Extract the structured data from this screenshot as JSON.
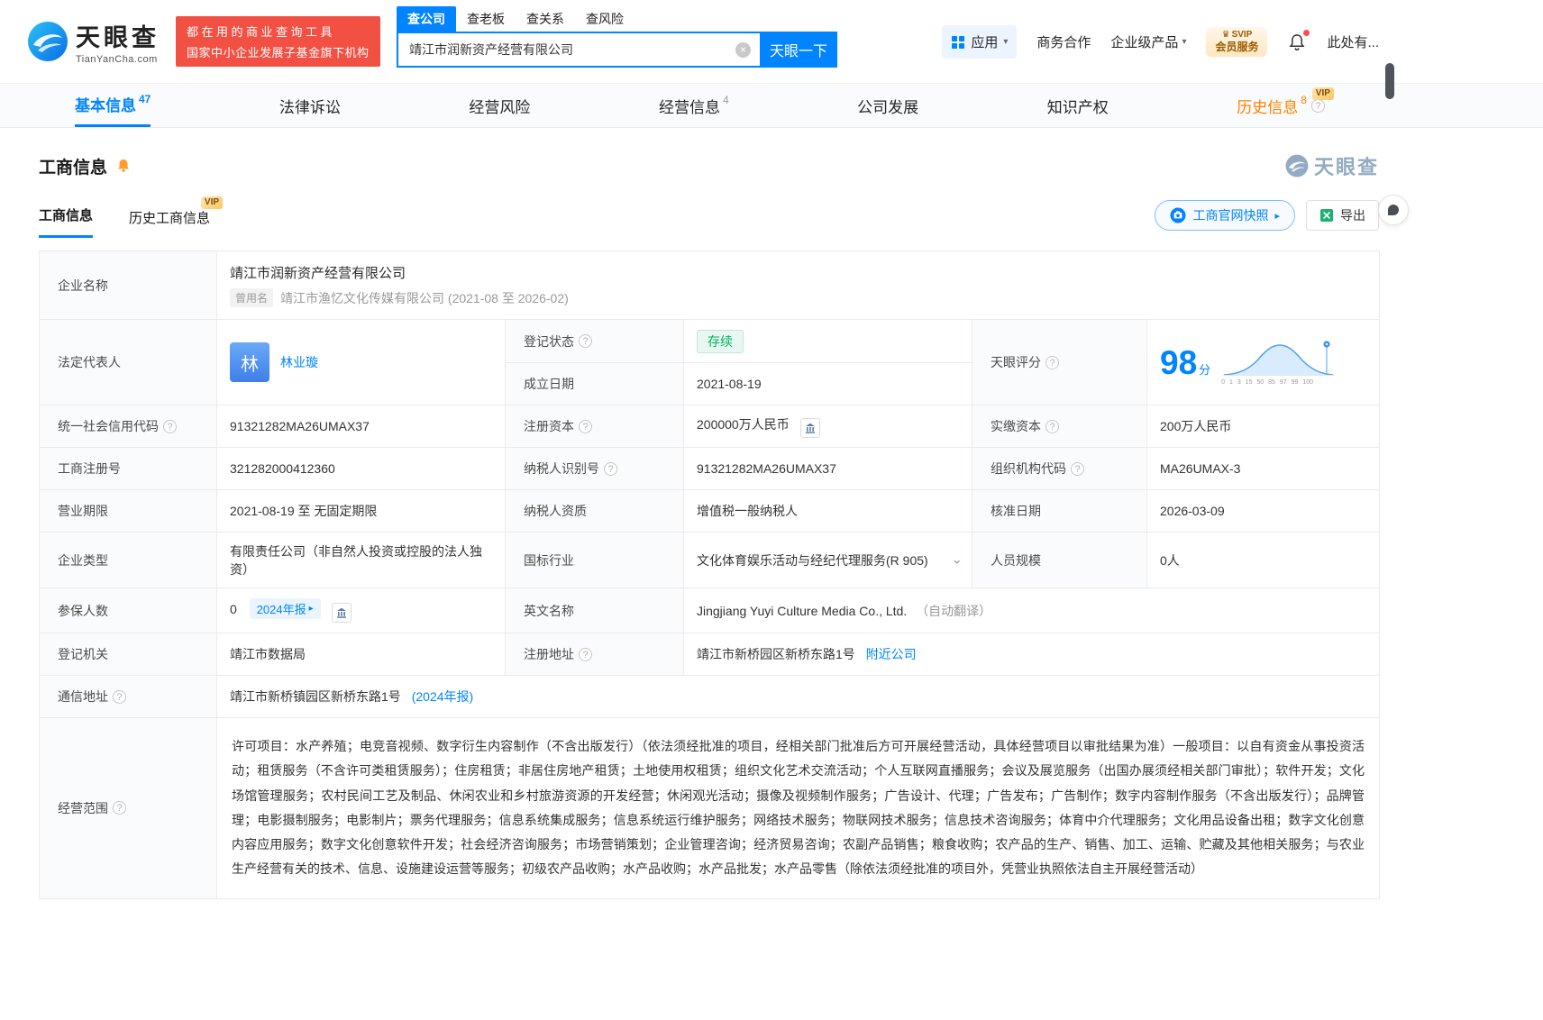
{
  "icons": {
    "help": "?",
    "caret_down": "▾",
    "arrow_right": "▸",
    "chevron_down": "⌄",
    "close": "×",
    "crown": "♛"
  },
  "badges": {
    "vip": "VIP"
  },
  "header": {
    "logo": {
      "cn": "天眼查",
      "en": "TianYanCha.com"
    },
    "promo": {
      "line1": "都在用的商业查询工具",
      "line2": "国家中小企业发展子基金旗下机构"
    },
    "search": {
      "tabs": [
        {
          "label": "查公司"
        },
        {
          "label": "查老板"
        },
        {
          "label": "查关系"
        },
        {
          "label": "查风险"
        }
      ],
      "value": "靖江市润新资产经营有限公司",
      "button": "天眼一下"
    },
    "menu": {
      "apps": "应用",
      "cooperation": "商务合作",
      "enterprise": "企业级产品",
      "svip_top": "SVIP",
      "svip_bottom": "会员服务",
      "more": "此处有..."
    }
  },
  "nav": [
    {
      "label": "基本信息",
      "count": "47"
    },
    {
      "label": "法律诉讼",
      "count": ""
    },
    {
      "label": "经营风险",
      "count": ""
    },
    {
      "label": "经营信息",
      "count": "4"
    },
    {
      "label": "公司发展",
      "count": ""
    },
    {
      "label": "知识产权",
      "count": ""
    },
    {
      "label": "历史信息",
      "count": "8"
    }
  ],
  "section": {
    "title": "工商信息",
    "brand": "天眼查",
    "tab_current": "工商信息",
    "tab_history": "历史工商信息",
    "snapshot": "工商官网快照",
    "export": "导出"
  },
  "table": {
    "company_name": {
      "label": "企业名称",
      "value": "靖江市润新资产经营有限公司",
      "former_badge": "曾用名",
      "former": "靖江市渔忆文化传媒有限公司 (2021-08 至 2026-02)"
    },
    "legal_rep": {
      "label": "法定代表人",
      "avatar": "林",
      "name": "林业璇"
    },
    "reg_status": {
      "label": "登记状态",
      "value": "存续"
    },
    "score": {
      "label": "天眼评分",
      "value": "98",
      "unit": "分",
      "axis": "0 1 3 15 50 85 97 99 100"
    },
    "established": {
      "label": "成立日期",
      "value": "2021-08-19"
    },
    "credit_code": {
      "label": "统一社会信用代码",
      "value": "91321282MA26UMAX37"
    },
    "reg_capital": {
      "label": "注册资本",
      "value": "200000万人民币"
    },
    "paid_capital": {
      "label": "实缴资本",
      "value": "200万人民币"
    },
    "reg_no": {
      "label": "工商注册号",
      "value": "321282000412360"
    },
    "tax_id": {
      "label": "纳税人识别号",
      "value": "91321282MA26UMAX37"
    },
    "org_code": {
      "label": "组织机构代码",
      "value": "MA26UMAX-3"
    },
    "term": {
      "label": "营业期限",
      "value": "2021-08-19 至 无固定期限"
    },
    "tax_quality": {
      "label": "纳税人资质",
      "value": "增值税一般纳税人"
    },
    "approval_date": {
      "label": "核准日期",
      "value": "2026-03-09"
    },
    "company_type": {
      "label": "企业类型",
      "value": "有限责任公司（非自然人投资或控股的法人独资）"
    },
    "industry": {
      "label": "国标行业",
      "value": "文化体育娱乐活动与经纪代理服务(R 905)"
    },
    "staff": {
      "label": "人员规模",
      "value": "0人"
    },
    "insured": {
      "label": "参保人数",
      "value": "0",
      "report": "2024年报"
    },
    "en_name": {
      "label": "英文名称",
      "value": "Jingjiang Yuyi Culture Media Co., Ltd.",
      "note": "（自动翻译）"
    },
    "authority": {
      "label": "登记机关",
      "value": "靖江市数据局"
    },
    "reg_address": {
      "label": "注册地址",
      "value": "靖江市新桥园区新桥东路1号",
      "nearby": "附近公司"
    },
    "mail_address": {
      "label": "通信地址",
      "value": "靖江市新桥镇园区新桥东路1号",
      "report": "(2024年报)"
    },
    "scope": {
      "label": "经营范围",
      "value": "许可项目：水产养殖；电竞音视频、数字衍生内容制作（不含出版发行）（依法须经批准的项目，经相关部门批准后方可开展经营活动，具体经营项目以审批结果为准）一般项目：以自有资金从事投资活动；租赁服务（不含许可类租赁服务）；住房租赁；非居住房地产租赁；土地使用权租赁；组织文化艺术交流活动；个人互联网直播服务；会议及展览服务（出国办展须经相关部门审批）；软件开发；文化场馆管理服务；农村民间工艺及制品、休闲农业和乡村旅游资源的开发经营；休闲观光活动；摄像及视频制作服务；广告设计、代理；广告发布；广告制作；数字内容制作服务（不含出版发行）；品牌管理；电影摄制服务；电影制片；票务代理服务；信息系统集成服务；信息系统运行维护服务；网络技术服务；物联网技术服务；信息技术咨询服务；体育中介代理服务；文化用品设备出租；数字文化创意内容应用服务；数字文化创意软件开发；社会经济咨询服务；市场营销策划；企业管理咨询；经济贸易咨询；农副产品销售；粮食收购；农产品的生产、销售、加工、运输、贮藏及其他相关服务；与农业生产经营有关的技术、信息、设施建设运营等服务；初级农产品收购；水产品收购；水产品批发；水产品零售（除依法须经批准的项目外，凭营业执照依法自主开展经营活动）"
    }
  }
}
